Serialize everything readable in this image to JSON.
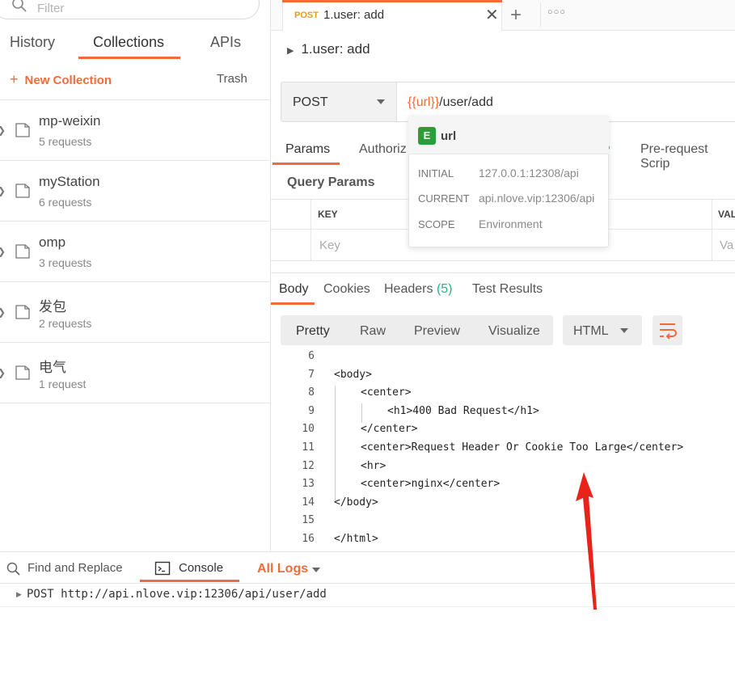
{
  "sidebar": {
    "filter_placeholder": "Filter",
    "tabs": [
      "History",
      "Collections",
      "APIs"
    ],
    "new_collection": "New Collection",
    "trash": "Trash",
    "collections": [
      {
        "name": "mp-weixin",
        "count": "5 requests"
      },
      {
        "name": "myStation",
        "count": "6 requests"
      },
      {
        "name": "omp",
        "count": "3 requests"
      },
      {
        "name": "发包",
        "count": "2 requests"
      },
      {
        "name": "电气",
        "count": "1 request"
      }
    ]
  },
  "tab": {
    "method": "POST",
    "title": "1.user: add"
  },
  "request": {
    "title": "1.user: add",
    "method": "POST",
    "url_var": "{{url}}",
    "url_path": "/user/add",
    "tabs": [
      "Params",
      "Authoriz",
      "Pre-request Scrip"
    ],
    "query_params_title": "Query Params",
    "key_header": "KEY",
    "value_header": "VAL",
    "key_placeholder": "Key",
    "value_placeholder": "Va"
  },
  "variable_tooltip": {
    "badge": "E",
    "name": "url",
    "rows": [
      {
        "label": "INITIAL",
        "value": "127.0.0.1:12308/api"
      },
      {
        "label": "CURRENT",
        "value": "api.nlove.vip:12306/api"
      },
      {
        "label": "SCOPE",
        "value": "Environment"
      }
    ]
  },
  "response": {
    "tabs": {
      "body": "Body",
      "cookies": "Cookies",
      "headers": "Headers",
      "headers_count": "(5)",
      "test_results": "Test Results"
    },
    "view_modes": [
      "Pretty",
      "Raw",
      "Preview",
      "Visualize"
    ],
    "format": "HTML",
    "code_lines": [
      {
        "n": "6",
        "indent": 0,
        "text": ""
      },
      {
        "n": "7",
        "indent": 0,
        "text": "<body>"
      },
      {
        "n": "8",
        "indent": 1,
        "text": "<center>"
      },
      {
        "n": "9",
        "indent": 2,
        "text": "<h1>400 Bad Request</h1>"
      },
      {
        "n": "10",
        "indent": 1,
        "text": "</center>"
      },
      {
        "n": "11",
        "indent": 1,
        "text": "<center>Request Header Or Cookie Too Large</center>"
      },
      {
        "n": "12",
        "indent": 1,
        "text": "<hr>"
      },
      {
        "n": "13",
        "indent": 1,
        "text": "<center>nginx</center>"
      },
      {
        "n": "14",
        "indent": 0,
        "text": "</body>"
      },
      {
        "n": "15",
        "indent": 0,
        "text": ""
      },
      {
        "n": "16",
        "indent": 0,
        "text": "</html>"
      }
    ]
  },
  "console": {
    "find_replace": "Find and Replace",
    "console_label": "Console",
    "filter": "All Logs",
    "log_entry": "POST http://api.nlove.vip:12306/api/user/add"
  },
  "colors": {
    "accent": "#f26b3a",
    "env_badge": "#2d9d3a",
    "annotation_arrow": "#e8231a"
  }
}
